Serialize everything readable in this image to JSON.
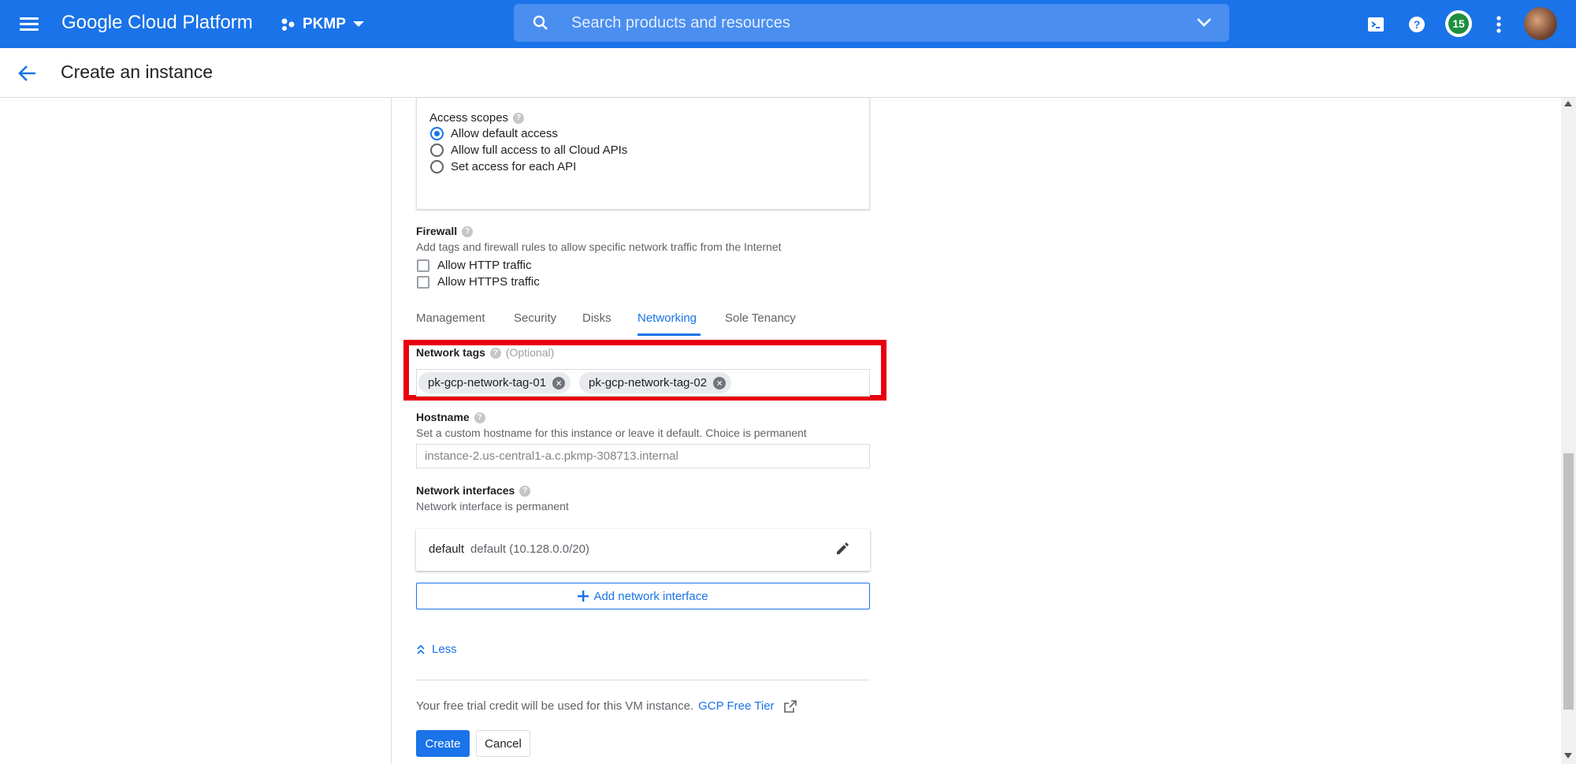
{
  "topbar": {
    "app_title": "Google Cloud Platform",
    "project_name": "PKMP",
    "search_placeholder": "Search products and resources",
    "notification_count": "15",
    "colors": {
      "bar": "#1a73e8",
      "badge": "#1e8e3e"
    }
  },
  "header": {
    "title": "Create an instance"
  },
  "access_scopes": {
    "label": "Access scopes",
    "options": [
      {
        "label": "Allow default access",
        "selected": true
      },
      {
        "label": "Allow full access to all Cloud APIs",
        "selected": false
      },
      {
        "label": "Set access for each API",
        "selected": false
      }
    ]
  },
  "firewall": {
    "label": "Firewall",
    "description": "Add tags and firewall rules to allow specific network traffic from the Internet",
    "options": [
      {
        "label": "Allow HTTP traffic",
        "checked": false
      },
      {
        "label": "Allow HTTPS traffic",
        "checked": false
      }
    ]
  },
  "tabs": [
    {
      "label": "Management",
      "active": false
    },
    {
      "label": "Security",
      "active": false
    },
    {
      "label": "Disks",
      "active": false
    },
    {
      "label": "Networking",
      "active": true
    },
    {
      "label": "Sole Tenancy",
      "active": false
    }
  ],
  "network_tags": {
    "label": "Network tags",
    "optional": "(Optional)",
    "tags": [
      "pk-gcp-network-tag-01",
      "pk-gcp-network-tag-02"
    ]
  },
  "hostname": {
    "label": "Hostname",
    "description": "Set a custom hostname for this instance or leave it default. Choice is permanent",
    "placeholder": "instance-2.us-central1-a.c.pkmp-308713.internal"
  },
  "network_interfaces": {
    "label": "Network interfaces",
    "description": "Network interface is permanent",
    "interface_name": "default",
    "interface_detail": "default (10.128.0.0/20)",
    "add_label": "Add network interface"
  },
  "less_label": "Less",
  "footer": {
    "free_trial_text": "Your free trial credit will be used for this VM instance.",
    "free_tier_link": "GCP Free Tier",
    "create_label": "Create",
    "cancel_label": "Cancel"
  }
}
